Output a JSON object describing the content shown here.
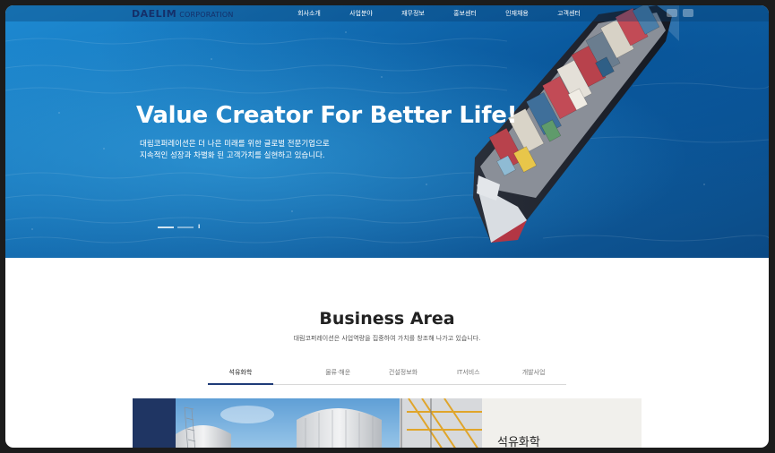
{
  "header": {
    "logo_main": "DAELIM",
    "logo_sub": "CORPORATION",
    "menu": [
      {
        "label": "회사소개"
      },
      {
        "label": "사업분야"
      },
      {
        "label": "재무정보"
      },
      {
        "label": "홍보센터"
      },
      {
        "label": "인재채용"
      },
      {
        "label": "고객센터"
      }
    ]
  },
  "hero": {
    "title": "Value Creator For Better Life!",
    "desc_line1": "대림코퍼레이션은 더 나은 미래를 위한 글로벌 전문기업으로",
    "desc_line2": "지속적인 성장과 차별화 된 고객가치를 실현하고 있습니다.",
    "pause_symbol": "II"
  },
  "business": {
    "title": "Business Area",
    "subtitle": "대림코퍼레이션은 사업역량을 집중하여 가치를 창조해 나가고 있습니다.",
    "tabs": [
      {
        "label": "석유화학"
      },
      {
        "label": "물류·해운"
      },
      {
        "label": "건설정보화"
      },
      {
        "label": "IT서비스"
      },
      {
        "label": "개발사업"
      }
    ],
    "active_tab": "석유화학",
    "card_title": "석유화학"
  },
  "colors": {
    "brand_navy": "#1f3563",
    "active_tab_underline": "#1f3b78",
    "sea": "#1674b9"
  }
}
